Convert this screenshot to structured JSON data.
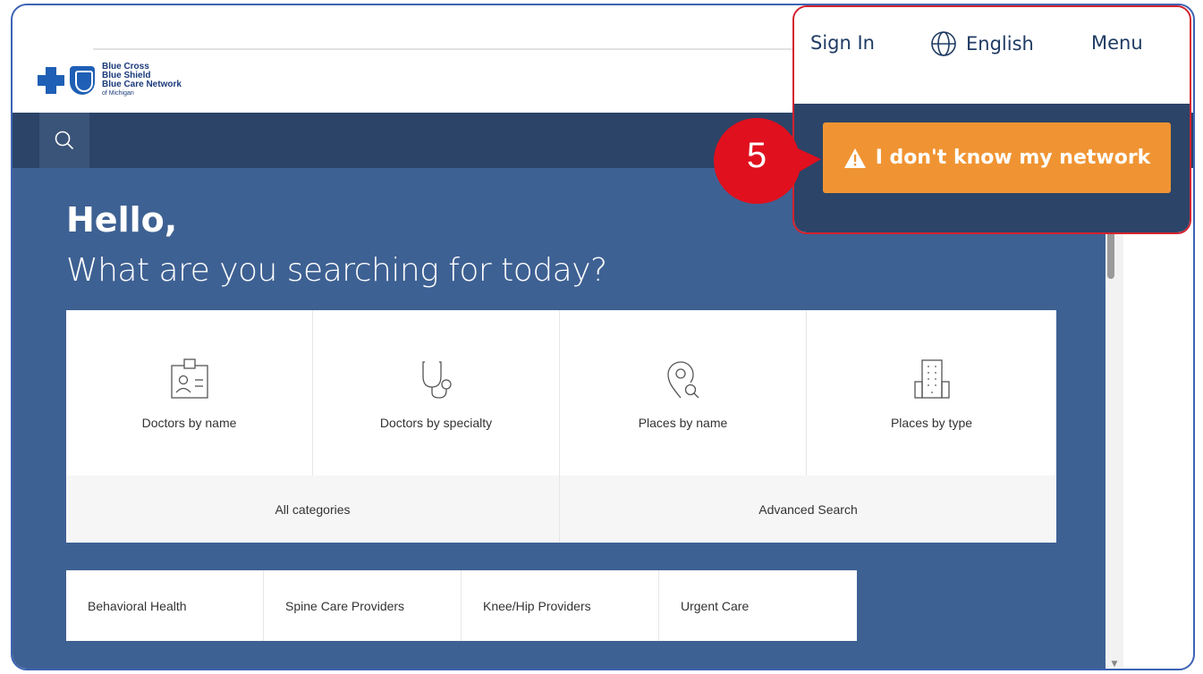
{
  "header": {
    "logo_line1": "Blue Cross",
    "logo_line2": "Blue Shield",
    "logo_line3": "Blue Care Network",
    "logo_line4": "of Michigan"
  },
  "topnav": {
    "sign_in": "Sign In",
    "language": "English",
    "menu": "Menu",
    "network_button": "I don't know my network",
    "globe_icon": "globe-icon",
    "warning_icon": "warning-icon"
  },
  "annotation": {
    "step_number": "5",
    "color": "#d3222f"
  },
  "hero": {
    "greeting": "Hello,",
    "subtitle": "What are you searching for today?"
  },
  "categories": [
    {
      "label": "Doctors by name",
      "icon": "id-card-icon"
    },
    {
      "label": "Doctors by specialty",
      "icon": "stethoscope-icon"
    },
    {
      "label": "Places by name",
      "icon": "location-search-icon"
    },
    {
      "label": "Places by type",
      "icon": "building-icon"
    }
  ],
  "category_links": {
    "all": "All categories",
    "advanced": "Advanced Search"
  },
  "quick_links": [
    "Behavioral Health",
    "Spine Care Providers",
    "Knee/Hip Providers",
    "Urgent Care"
  ],
  "colors": {
    "navy": "#2b4468",
    "hero_blue": "#3e6193",
    "orange": "#f09433",
    "annotation_red": "#d3222f"
  }
}
